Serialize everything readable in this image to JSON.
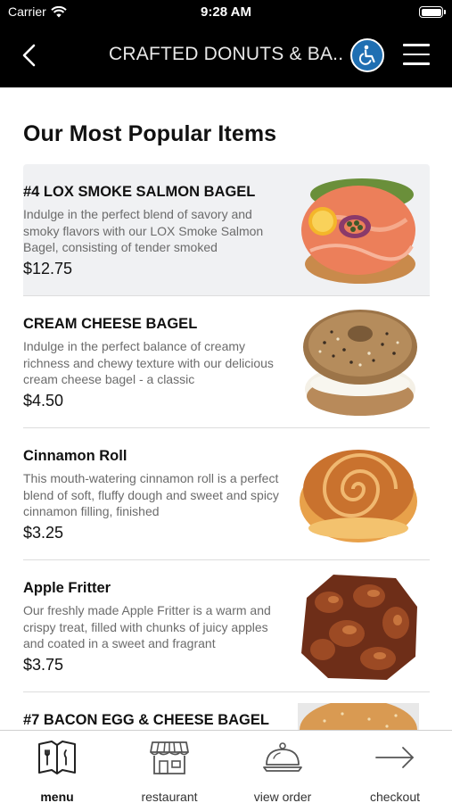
{
  "status_bar": {
    "carrier": "Carrier",
    "time": "9:28 AM"
  },
  "nav": {
    "title": "CRAFTED DONUTS & BA...",
    "back_icon": "chevron-left-icon",
    "accessibility_icon": "wheelchair-icon",
    "menu_icon": "hamburger-icon"
  },
  "page": {
    "heading": "Our Most Popular Items"
  },
  "items": [
    {
      "name": "#4 LOX SMOKE SALMON BAGEL",
      "description": "Indulge in the perfect blend of savory and smoky flavors with our LOX Smoke Salmon Bagel, consisting of tender smoked",
      "price": "$12.75"
    },
    {
      "name": "CREAM CHEESE BAGEL",
      "description": "Indulge in the perfect balance of creamy richness and chewy texture with our delicious cream cheese bagel - a classic",
      "price": "$4.50"
    },
    {
      "name": "Cinnamon Roll",
      "description": "This mouth-watering cinnamon roll is a perfect blend of soft, fluffy dough and sweet and spicy cinnamon filling, finished",
      "price": "$3.25"
    },
    {
      "name": "Apple Fritter",
      "description": "Our freshly made Apple Fritter is a warm and crispy treat, filled with chunks of juicy apples and coated in a sweet and fragrant",
      "price": "$3.75"
    },
    {
      "name": "#7 BACON EGG & CHEESE BAGEL",
      "description": "",
      "price": ""
    }
  ],
  "tabbar": {
    "tabs": [
      {
        "label": "menu",
        "icon": "menu-book-icon",
        "active": true
      },
      {
        "label": "restaurant",
        "icon": "storefront-icon",
        "active": false
      },
      {
        "label": "view order",
        "icon": "cloche-icon",
        "active": false
      },
      {
        "label": "checkout",
        "icon": "arrow-right-icon",
        "active": false
      }
    ]
  },
  "colors": {
    "header_bg": "#000000",
    "accessibility_blue": "#1f6fb2",
    "highlight_bg": "#f0f1f3"
  }
}
